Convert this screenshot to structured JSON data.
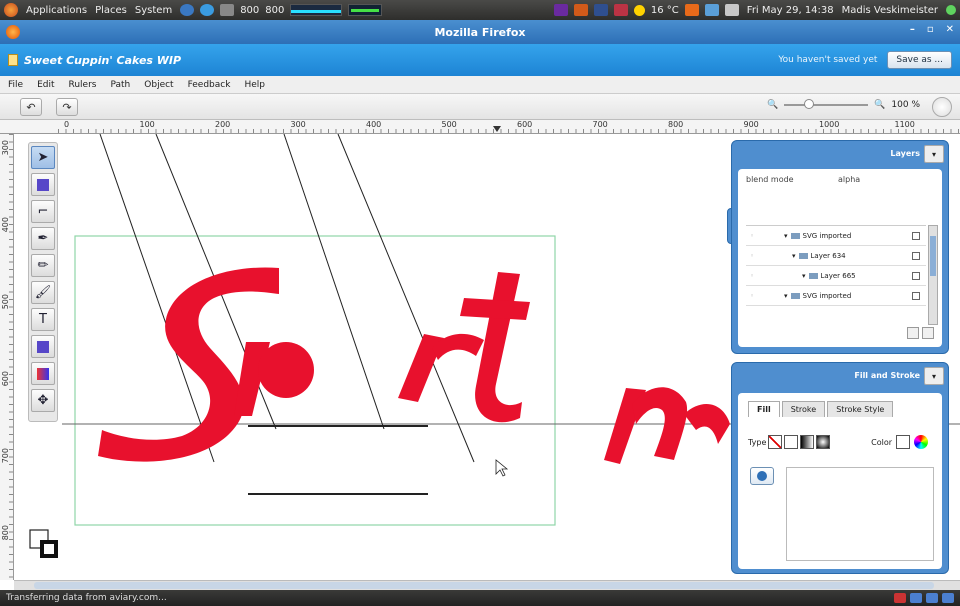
{
  "panel": {
    "applications": "Applications",
    "places": "Places",
    "system": "System",
    "cpu": "800",
    "cpu2": "800",
    "weather": "16 °C",
    "clock": "Fri May 29, 14:38",
    "user": "Madis Veskimeister"
  },
  "firefox": {
    "title": "Mozilla Firefox"
  },
  "app": {
    "doc_title": "Sweet Cuppin' Cakes WIP",
    "unsaved": "You haven't saved yet",
    "save_as": "Save as ..."
  },
  "menu": {
    "items": [
      "File",
      "Edit",
      "Rulers",
      "Path",
      "Object",
      "Feedback",
      "Help"
    ]
  },
  "toolbar": {
    "zoom_pct": "100 %",
    "undo": "↶",
    "redo": "↷"
  },
  "ruler": {
    "h_labels": [
      "0",
      "100",
      "200",
      "300",
      "400",
      "500",
      "600",
      "700",
      "800",
      "900",
      "1000",
      "1100"
    ],
    "v_labels": [
      "300",
      "400",
      "500",
      "600",
      "700",
      "800"
    ]
  },
  "tools": [
    "select",
    "node",
    "crop",
    "pen",
    "pencil",
    "brush",
    "text",
    "rect",
    "gradient",
    "transform"
  ],
  "layers": {
    "title": "Layers",
    "blend_mode": "blend mode",
    "alpha": "alpha",
    "rows": [
      "SVG imported",
      "Layer 634",
      "Layer 665",
      "SVG imported"
    ]
  },
  "fill": {
    "title": "Fill and Stroke",
    "tabs": [
      "Fill",
      "Stroke",
      "Stroke Style"
    ],
    "type_label": "Type",
    "color_label": "Color"
  },
  "status": {
    "text": "Transferring data from aviary.com..."
  },
  "colors": {
    "art_red": "#e8112d",
    "panel_blue": "#4f8ecf",
    "header_blue": "#1d84d4"
  }
}
